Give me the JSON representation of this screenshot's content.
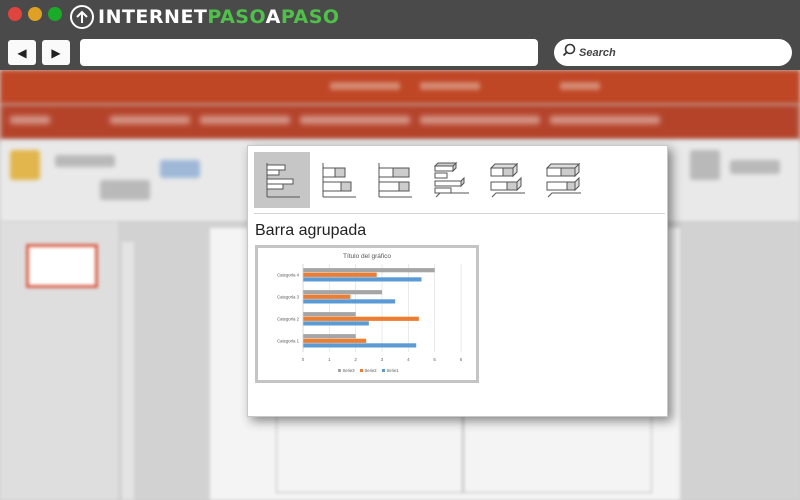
{
  "browser": {
    "logo": {
      "part1": "INTERNET",
      "part2": "PASO",
      "part3": "A",
      "part4": "PASO"
    },
    "nav": {
      "back_icon": "◀",
      "forward_icon": "▶"
    },
    "address": {
      "value": ""
    },
    "search": {
      "label": "Search"
    }
  },
  "popup": {
    "chart_types": [
      {
        "name": "clustered-bar",
        "selected": true
      },
      {
        "name": "stacked-bar",
        "selected": false
      },
      {
        "name": "100-stacked-bar",
        "selected": false
      },
      {
        "name": "3d-clustered-bar",
        "selected": false
      },
      {
        "name": "3d-stacked-bar",
        "selected": false
      },
      {
        "name": "3d-100-stacked-bar",
        "selected": false
      }
    ],
    "selected_label": "Barra agrupada"
  },
  "chart_data": {
    "type": "bar",
    "orientation": "horizontal",
    "title": "Título del gráfico",
    "categories": [
      "Categoría 1",
      "Categoría 2",
      "Categoría 3",
      "Categoría 4"
    ],
    "series": [
      {
        "name": "Serie1",
        "color": "#5b9bd5",
        "values": [
          4.3,
          2.5,
          3.5,
          4.5
        ]
      },
      {
        "name": "Serie2",
        "color": "#ed7d31",
        "values": [
          2.4,
          4.4,
          1.8,
          2.8
        ]
      },
      {
        "name": "Serie3",
        "color": "#a5a5a5",
        "values": [
          2.0,
          2.0,
          3.0,
          5.0
        ]
      }
    ],
    "xlim": [
      0,
      6
    ],
    "xticks": [
      "0",
      "1",
      "2",
      "3",
      "4",
      "5",
      "6"
    ],
    "grid": true,
    "legend_position": "bottom",
    "legend_order": [
      "Serie3",
      "Serie2",
      "Serie1"
    ]
  }
}
